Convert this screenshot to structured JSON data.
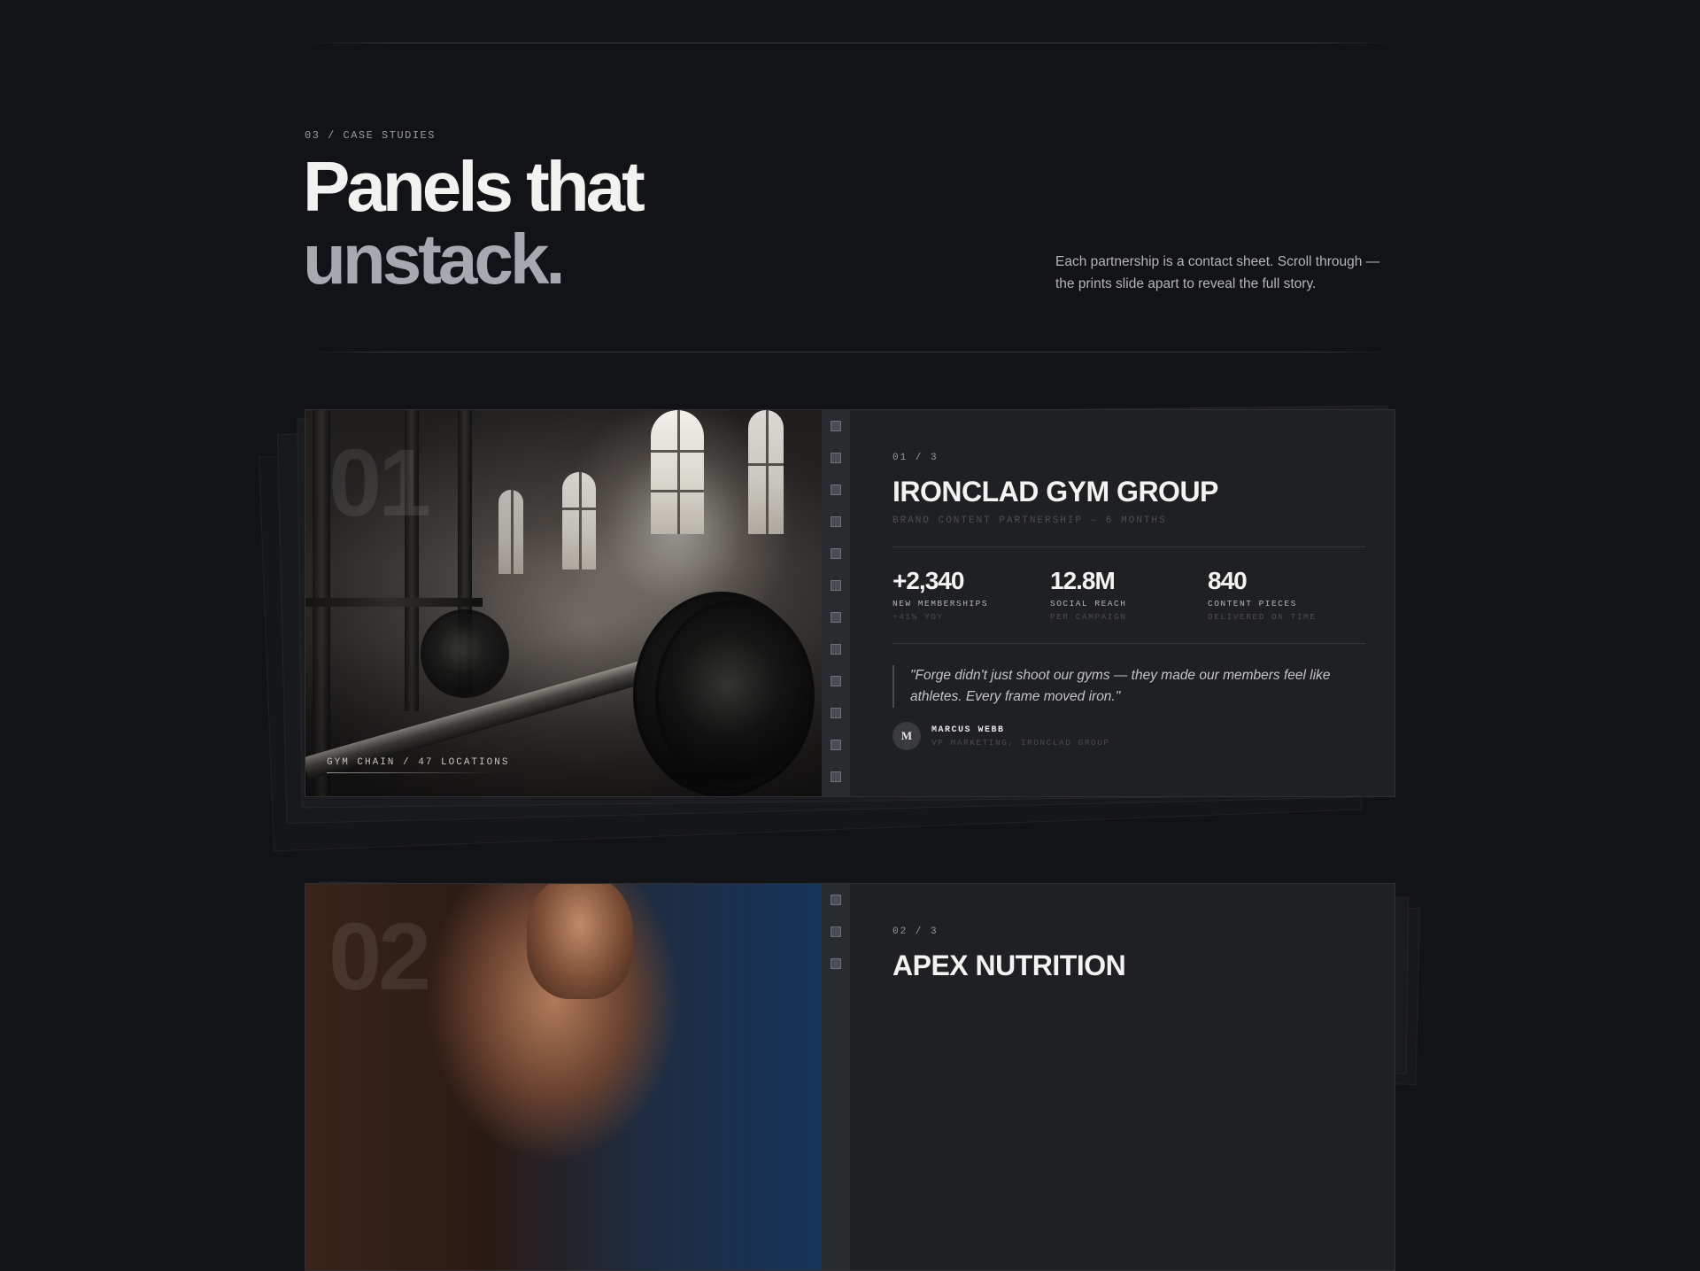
{
  "section": {
    "eyebrow": "03 / CASE STUDIES",
    "headline_line1": "Panels that",
    "headline_line2": "unstack.",
    "intro": "Each partnership is a contact sheet. Scroll through — the prints slide apart to reveal the full story."
  },
  "cases": [
    {
      "big_number": "01",
      "index": "01 / 3",
      "title": "IRONCLAD GYM GROUP",
      "subtitle": "BRAND CONTENT PARTNERSHIP — 6 MONTHS",
      "photo_caption": "GYM CHAIN / 47 LOCATIONS",
      "stats": [
        {
          "value": "+2,340",
          "label": "NEW MEMBERSHIPS",
          "note": "+41% YOY"
        },
        {
          "value": "12.8M",
          "label": "SOCIAL REACH",
          "note": "PER CAMPAIGN"
        },
        {
          "value": "840",
          "label": "CONTENT PIECES",
          "note": "DELIVERED ON TIME"
        }
      ],
      "quote": "\"Forge didn't just shoot our gyms — they made our members feel like athletes. Every frame moved iron.\"",
      "author_initial": "M",
      "author_name": "MARCUS WEBB",
      "author_role": "VP MARKETING, IRONCLAD GROUP"
    },
    {
      "big_number": "02",
      "index": "02 / 3",
      "title": "APEX NUTRITION"
    }
  ],
  "colors": {
    "background": "#121316",
    "card": "#1f2023",
    "headline_primary": "#f2f2f0",
    "headline_secondary": "#a7a8b0",
    "sprocket": "#4b4c58"
  }
}
